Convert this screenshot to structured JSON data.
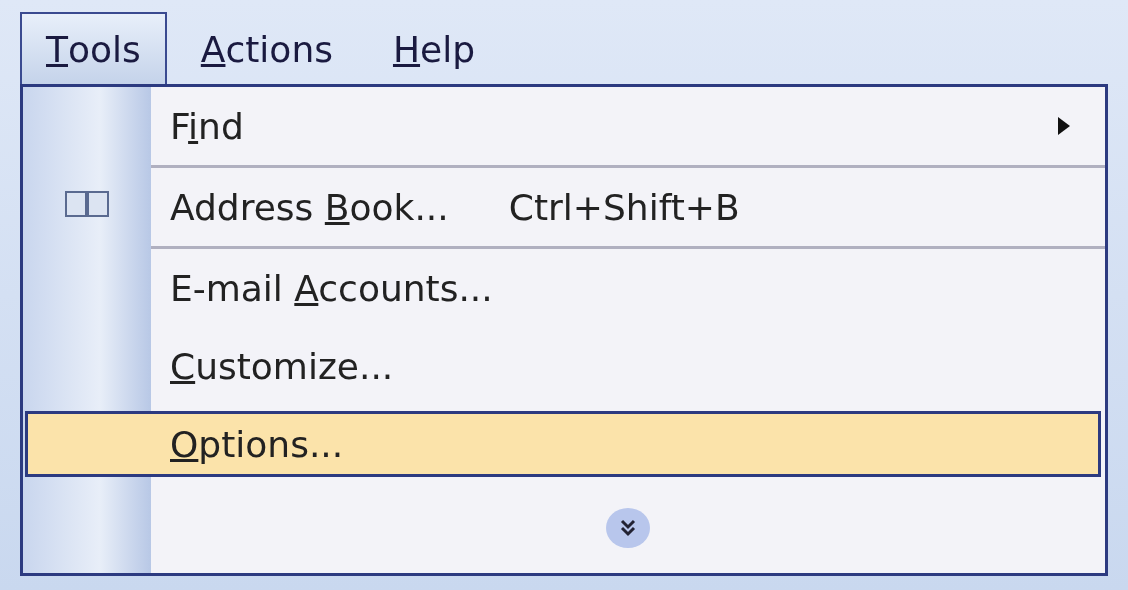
{
  "menubar": [
    {
      "label": {
        "key": "T",
        "after": "ools"
      },
      "selected": true
    },
    {
      "label": {
        "key": "A",
        "after": "ctions"
      },
      "selected": false
    },
    {
      "label": {
        "key": "H",
        "after": "elp"
      },
      "selected": false
    }
  ],
  "menu": {
    "items": [
      {
        "label": {
          "before": "F",
          "key": "i",
          "after": "nd"
        },
        "submenu": true,
        "separator_after": true,
        "selected": false
      },
      {
        "label": {
          "before": "Address ",
          "key": "B",
          "after": "ook..."
        },
        "shortcut": "Ctrl+Shift+B",
        "icon": true,
        "separator_after": true,
        "selected": false
      },
      {
        "label": {
          "before": "E-mail ",
          "key": "A",
          "after": "ccounts..."
        },
        "selected": false
      },
      {
        "label": {
          "key": "C",
          "after": "ustomize..."
        },
        "selected": false
      },
      {
        "label": {
          "key": "O",
          "after": "ptions..."
        },
        "selected": true
      }
    ],
    "expand": true
  }
}
